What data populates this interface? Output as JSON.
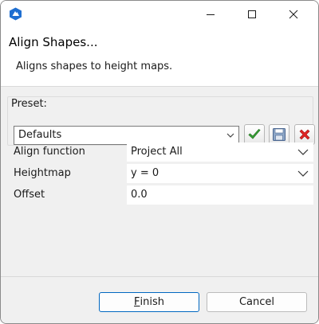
{
  "window": {
    "minimize_icon": "minimize-icon",
    "maximize_icon": "maximize-icon",
    "close_icon": "close-icon"
  },
  "header": {
    "title": "Align Shapes...",
    "description": "Aligns shapes to height maps."
  },
  "preset": {
    "label": "Preset:",
    "selected": "Defaults",
    "apply_icon": "checkmark-icon",
    "save_icon": "floppy-disk-icon",
    "delete_icon": "red-x-icon"
  },
  "properties": [
    {
      "label": "Align function",
      "value": "Project All",
      "dropdown": true
    },
    {
      "label": "Heightmap",
      "value": "y = 0",
      "dropdown": true
    },
    {
      "label": "Offset",
      "value": "0.0",
      "dropdown": false
    }
  ],
  "buttons": {
    "finish_mnemonic": "F",
    "finish_rest": "inish",
    "cancel": "Cancel"
  },
  "colors": {
    "accent": "#0067c0",
    "app_icon": "#1f6fd1",
    "apply_green": "#3aa33a",
    "delete_red": "#e02424"
  }
}
